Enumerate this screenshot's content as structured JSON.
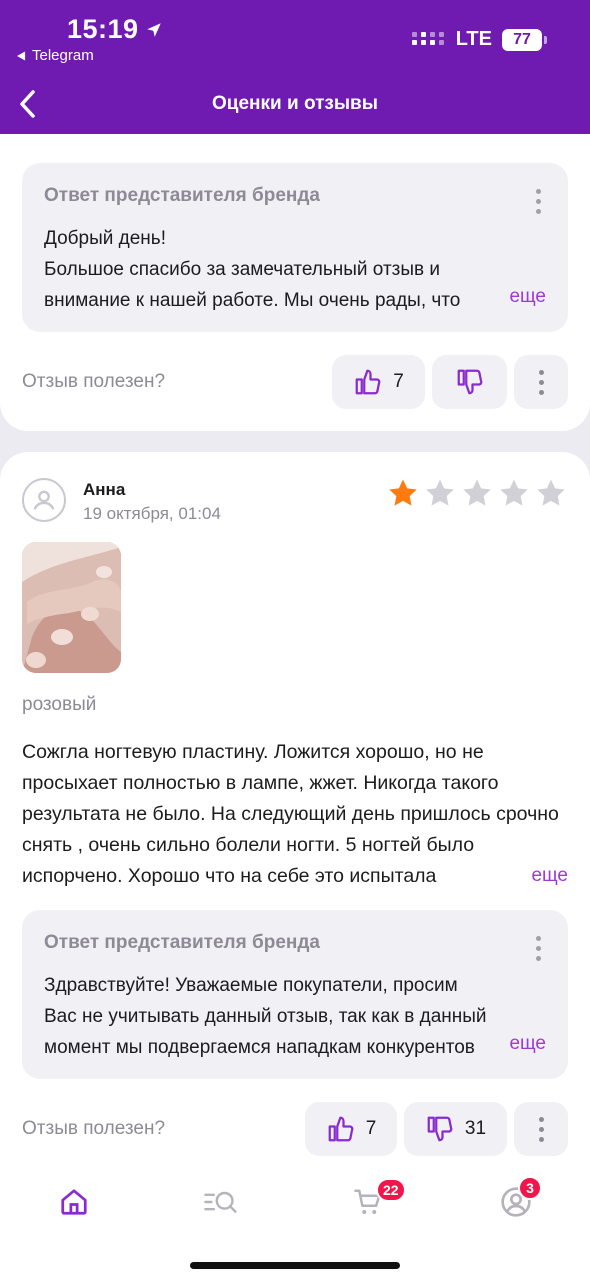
{
  "status_bar": {
    "time": "15:19",
    "back_app": "Telegram",
    "network": "LTE",
    "battery": "77"
  },
  "nav": {
    "title": "Оценки и отзывы"
  },
  "review_top": {
    "reply": {
      "title": "Ответ представителя бренда",
      "text": "Добрый день!\nБольшое спасибо за замечательный отзыв и\nвнимание к нашей работе. Мы очень рады, что",
      "more": "еще"
    },
    "helpful": {
      "label": "Отзыв полезен?",
      "likes": "7",
      "dislikes": ""
    }
  },
  "review_main": {
    "author": "Анна",
    "date": "19 октября, 01:04",
    "rating": 1,
    "max_rating": 5,
    "variant": "розовый",
    "text": "Сожгла ногтевую пластину. Ложится хорошо, но не просыхает полностью в лампе, жжет.  Никогда такого результата не было. На следующий день пришлось срочно снять , очень сильно болели ногти. 5 ногтей было испорчено. Хорошо что на себе это испытала",
    "more": "еще",
    "reply": {
      "title": "Ответ представителя бренда",
      "text": "Здравствуйте! Уважаемые покупатели, просим\nВас не учитывать данный отзыв, так как в данный\nмомент мы подвергаемся нападкам конкурентов",
      "more": "еще"
    },
    "helpful": {
      "label": "Отзыв полезен?",
      "likes": "7",
      "dislikes": "31"
    }
  },
  "tabbar": {
    "items": [
      {
        "name": "home",
        "icon": "home-icon",
        "active": true
      },
      {
        "name": "catalog",
        "icon": "catalog-search-icon"
      },
      {
        "name": "cart",
        "icon": "cart-icon",
        "badge": "22"
      },
      {
        "name": "profile",
        "icon": "profile-icon",
        "badge": "3"
      }
    ]
  },
  "colors": {
    "brand": "#6f1bb1",
    "accent": "#9b3ad6",
    "star": "#ff7a0f",
    "badge": "#f0164b"
  }
}
